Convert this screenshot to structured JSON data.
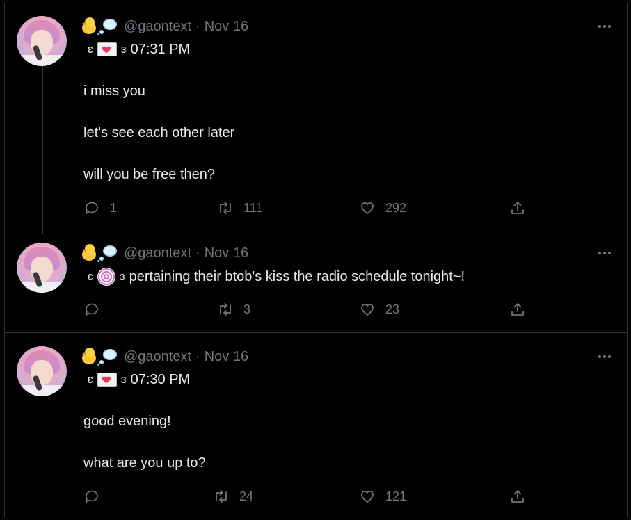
{
  "tweets": [
    {
      "handle": "@gaontext",
      "dot": "·",
      "date": "Nov 16",
      "bracket_left": "ɛ",
      "bracket_right": "ɜ",
      "emoji": "envelope-heart",
      "headline": "07:31 PM",
      "lines": [
        "i miss you",
        "let's see each other later",
        "will you be free then?"
      ],
      "replies": "1",
      "retweets": "111",
      "likes": "292"
    },
    {
      "handle": "@gaontext",
      "dot": "·",
      "date": "Nov 16",
      "bracket_left": "ɛ",
      "bracket_right": "ɜ",
      "emoji": "swirl",
      "headline": "pertaining their btob's kiss the radio schedule tonight~!",
      "lines": [],
      "replies": "",
      "retweets": "3",
      "likes": "23"
    },
    {
      "handle": "@gaontext",
      "dot": "·",
      "date": "Nov 16",
      "bracket_left": "ɛ",
      "bracket_right": "ɜ",
      "emoji": "envelope-heart",
      "headline": "07:30 PM",
      "lines": [
        "good evening!",
        "what are you up to?"
      ],
      "replies": "",
      "retweets": "24",
      "likes": "121"
    }
  ],
  "icons": {
    "reply": "reply-icon",
    "retweet": "retweet-icon",
    "like": "heart-icon",
    "share": "share-icon",
    "more": "more-icon"
  },
  "colors": {
    "background": "#000000",
    "text": "#e7e9ea",
    "muted": "#71767b",
    "border": "#2f3336"
  }
}
